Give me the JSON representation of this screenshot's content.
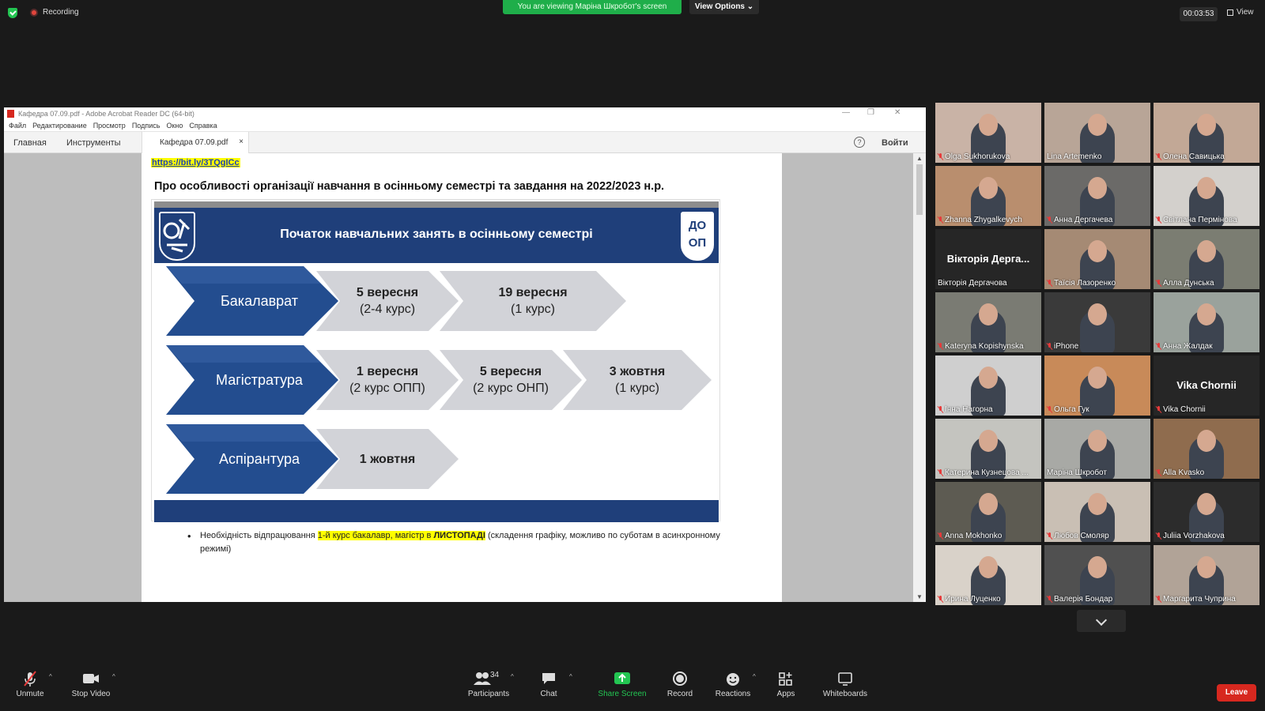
{
  "topbar": {
    "recording": "Recording",
    "viewing_banner": "You are viewing Марiна Шкробот's screen",
    "view_options": "View Options",
    "timer": "00:03:53",
    "view": "View"
  },
  "acrobat": {
    "window_title": "Кафедра 07.09.pdf - Adobe Acrobat Reader DC (64-bit)",
    "menu": [
      "Файл",
      "Редактирование",
      "Просмотр",
      "Подпись",
      "Окно",
      "Справка"
    ],
    "tab_home": "Главная",
    "tab_tools": "Инструменты",
    "doc_tab": "Кафедра 07.09.pdf",
    "help": "?",
    "login": "Войти"
  },
  "document": {
    "link": "https://bit.ly/3TQgICc",
    "heading": "Про особливості організації навчання в осінньому семестрі та завдання на 2022/2023 н.р.",
    "slide": {
      "title": "Початок навчальних занять в осінньому семестрі",
      "logo_right": [
        "ДО",
        "ОП"
      ],
      "rows": [
        {
          "label": "Бакалаврат",
          "items": [
            [
              "5 вересня",
              "(2-4 курс)"
            ],
            [
              "19 вересня",
              "(1 курс)"
            ]
          ]
        },
        {
          "label": "Магістратура",
          "items": [
            [
              "1 вересня",
              "(2 курс ОПП)"
            ],
            [
              "5 вересня",
              "(2 курс ОНП)"
            ],
            [
              "3 жовтня",
              "(1 курс)"
            ]
          ]
        },
        {
          "label": "Аспірантура",
          "items": [
            [
              "1 жовтня",
              ""
            ]
          ]
        }
      ]
    },
    "bullet": {
      "pre": "Необхідність відпрацювання ",
      "highlight": "1-й курс бакалавр, магістр в ",
      "highlight_bold": "ЛИСТОПАДІ",
      "post": " (складення графіку, можливо по суботам в асинхронному режимі)"
    }
  },
  "participants": [
    {
      "name": "Olga Sukhorukova",
      "muted": true,
      "bg": "#c9b3a6"
    },
    {
      "name": "Lina Artemenko",
      "muted": false,
      "bg": "#b8a597"
    },
    {
      "name": "Олена Савицька",
      "muted": true,
      "bg": "#c2a896"
    },
    {
      "name": "Zhanna Zhygalkevych",
      "muted": true,
      "bg": "#b98e6e"
    },
    {
      "name": "Анна Дергачева",
      "muted": true,
      "bg": "#6b6a68"
    },
    {
      "name": "Світлана Пермінова",
      "muted": true,
      "bg": "#d3d0cc"
    },
    {
      "name": "Вікторія Дергачова",
      "muted": false,
      "bg": "#262626",
      "big": "Вікторія Дерга..."
    },
    {
      "name": "Таїсія Лазоренко",
      "muted": true,
      "bg": "#a58a74"
    },
    {
      "name": "Алла Дунська",
      "muted": true,
      "bg": "#7b7d72"
    },
    {
      "name": "Kateryna Kopishynska",
      "muted": true,
      "bg": "#7a7b73"
    },
    {
      "name": "iPhone",
      "muted": true,
      "bg": "#3a3a3a"
    },
    {
      "name": "Анна Жалдак",
      "muted": true,
      "bg": "#9aa29c"
    },
    {
      "name": "Інна Нагорна",
      "muted": true,
      "bg": "#cfcfcf"
    },
    {
      "name": "Ольга Гук",
      "muted": true,
      "bg": "#c88a59"
    },
    {
      "name": "Vika Chornii",
      "muted": true,
      "bg": "#262626",
      "big": "Vika Chornii"
    },
    {
      "name": "Катерина Кузнецова ...",
      "muted": true,
      "bg": "#c4c4bf"
    },
    {
      "name": "Марiна Шкробот",
      "muted": false,
      "bg": "#a8a9a5",
      "active": true
    },
    {
      "name": "Alla Kvasko",
      "muted": true,
      "bg": "#8f6c4e"
    },
    {
      "name": "Anna Mokhonko",
      "muted": true,
      "bg": "#5d5b52"
    },
    {
      "name": "Любов Смоляр",
      "muted": true,
      "bg": "#c9bfb4"
    },
    {
      "name": "Juliia Vorzhakova",
      "muted": true,
      "bg": "#2c2c2c"
    },
    {
      "name": "Ирина Луценко",
      "muted": true,
      "bg": "#d9d2c9"
    },
    {
      "name": "Валерія Бондар",
      "muted": true,
      "bg": "#505050"
    },
    {
      "name": "Маргарита Чуприна",
      "muted": true,
      "bg": "#b1a397"
    }
  ],
  "toolbar": {
    "unmute": "Unmute",
    "stop_video": "Stop Video",
    "participants": "Participants",
    "participants_count": "34",
    "chat": "Chat",
    "share_screen": "Share Screen",
    "record": "Record",
    "reactions": "Reactions",
    "apps": "Apps",
    "whiteboards": "Whiteboards",
    "leave": "Leave"
  },
  "colors": {
    "accent_green": "#1fae4a",
    "slide_blue": "#1f3f7a",
    "leave_red": "#d7281f",
    "highlight_yellow": "#ffff00"
  }
}
